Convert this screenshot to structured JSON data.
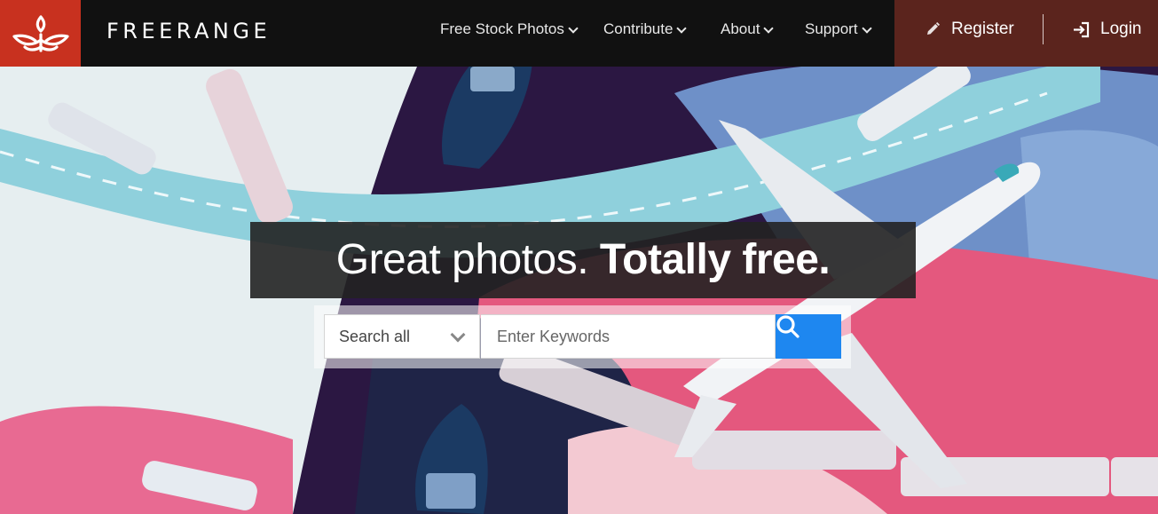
{
  "brand": {
    "name": "FREERANGE",
    "logo_icon": "freerange-bird-logo-icon",
    "logo_color": "#c8311f"
  },
  "nav": {
    "items": [
      {
        "label": "Free Stock Photos",
        "icon": "chevron-down-icon"
      },
      {
        "label": "Contribute",
        "icon": "chevron-down-icon"
      },
      {
        "label": "About",
        "icon": "chevron-down-icon"
      },
      {
        "label": "Support",
        "icon": "chevron-down-icon"
      }
    ],
    "register": {
      "label": "Register",
      "icon": "pencil-icon"
    },
    "login": {
      "label": "Login",
      "icon": "login-icon"
    },
    "auth_bg_color": "#5b241d"
  },
  "hero": {
    "headline_light": "Great photos. ",
    "headline_bold": "Totally free.",
    "illustration": "airplane-boats-and-trains-illustration"
  },
  "search": {
    "scope_selected": "Search all",
    "placeholder": "Enter Keywords",
    "value": "",
    "button_icon": "search-icon",
    "button_color": "#1e87f0"
  }
}
